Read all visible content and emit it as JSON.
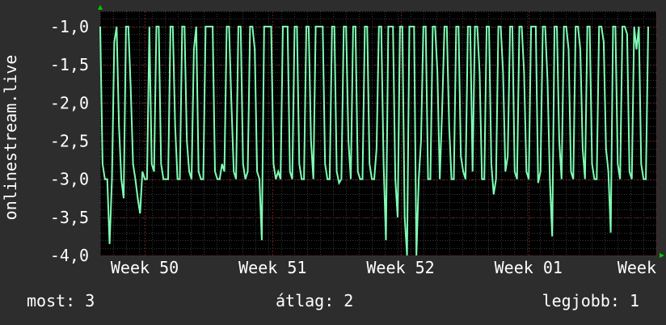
{
  "colors": {
    "background": "#2d2d2d",
    "plot_background": "#000000",
    "grid_major": "#6b2020",
    "grid_minor": "#3a3a3a",
    "line": "#7fffb4",
    "axis_arrow": "#00cc00",
    "text": "#ffffff"
  },
  "chart_data": {
    "type": "line",
    "ylabel": "onlinestream.live",
    "ylim": [
      -4.0,
      -0.8
    ],
    "yticks": [
      "-1,0",
      "-1,5",
      "-2,0",
      "-2,5",
      "-3,0",
      "-3,5",
      "-4,0"
    ],
    "ytick_values": [
      -1.0,
      -1.5,
      -2.0,
      -2.5,
      -3.0,
      -3.5,
      -4.0
    ],
    "xticks": [
      "Week 50",
      "Week 51",
      "Week 52",
      "Week 01",
      "Week"
    ],
    "xtick_positions": [
      0.08,
      0.31,
      0.54,
      0.77,
      1.0
    ],
    "grid": true,
    "series": [
      {
        "values": [
          -1,
          -2.8,
          -3,
          -3,
          -3.85,
          -3,
          -1.2,
          -1,
          -2.3,
          -3,
          -3.25,
          -1,
          -1,
          -1.8,
          -2.8,
          -3,
          -3.25,
          -3.45,
          -2.9,
          -3,
          -3,
          -1,
          -2.8,
          -2.9,
          -1,
          -1,
          -2.8,
          -3,
          -3,
          -3,
          -1,
          -1,
          -2.3,
          -3,
          -3,
          -1,
          -1,
          -2.5,
          -2.9,
          -3,
          -1.3,
          -1,
          -2.9,
          -3,
          -3,
          -1,
          -1,
          -1,
          -1,
          -2.9,
          -3,
          -3,
          -2.8,
          -2.9,
          -1,
          -1,
          -2,
          -2.9,
          -3,
          -1,
          -1,
          -2.8,
          -3,
          -2.9,
          -1,
          -1,
          -1.3,
          -2.9,
          -3,
          -3.8,
          -1,
          -1,
          -1,
          -1,
          -2.8,
          -3,
          -2.9,
          -3,
          -1,
          -1,
          -1,
          -2.9,
          -3,
          -1,
          -1,
          -2.8,
          -3,
          -3,
          -1,
          -1,
          -2.5,
          -3,
          -1,
          -1,
          -1,
          -1,
          -2.8,
          -3,
          -3,
          -1,
          -1,
          -2.9,
          -3.05,
          -3,
          -1,
          -1,
          -2.5,
          -3,
          -1,
          -1,
          -2.9,
          -3,
          -3,
          -1,
          -1,
          -2.8,
          -3,
          -3,
          -2.6,
          -1,
          -1,
          -2.8,
          -3.8,
          -1,
          -1,
          -1,
          -3,
          -3.5,
          -1,
          -1,
          -3.5,
          -4,
          -1,
          -1,
          -1,
          -4,
          -3,
          -2.5,
          -1,
          -1,
          -3,
          -3,
          -1,
          -1,
          -1.6,
          -3,
          -2.1,
          -1,
          -1,
          -2.3,
          -3,
          -3,
          -1,
          -1,
          -2.7,
          -2.9,
          -3,
          -1,
          -1,
          -2.9,
          -1,
          -1,
          -1.6,
          -3,
          -3,
          -1,
          -1,
          -2.8,
          -3.2,
          -3,
          -1,
          -1,
          -1.6,
          -2.9,
          -2.7,
          -1,
          -1,
          -2.9,
          -3,
          -1,
          -1,
          -1.6,
          -2.9,
          -3,
          -1,
          -1,
          -1,
          -3.05,
          -2.9,
          -1,
          -1,
          -1.7,
          -3,
          -3.75,
          -1,
          -1,
          -2.5,
          -3,
          -1,
          -1,
          -1.3,
          -2.9,
          -3,
          -1,
          -1,
          -1.3,
          -2.6,
          -3,
          -1,
          -1,
          -2.8,
          -3,
          -3,
          -1,
          -1,
          -1.2,
          -2.6,
          -2.9,
          -3.7,
          -1,
          -1,
          -2.8,
          -3,
          -1,
          -1,
          -1.1,
          -2.9,
          -3,
          -1,
          -1.3,
          -1,
          -2.8,
          -3,
          -3,
          -1
        ]
      }
    ]
  },
  "footer": {
    "current": "most: 3",
    "average": "átlag: 2",
    "best": "legjobb: 1"
  }
}
